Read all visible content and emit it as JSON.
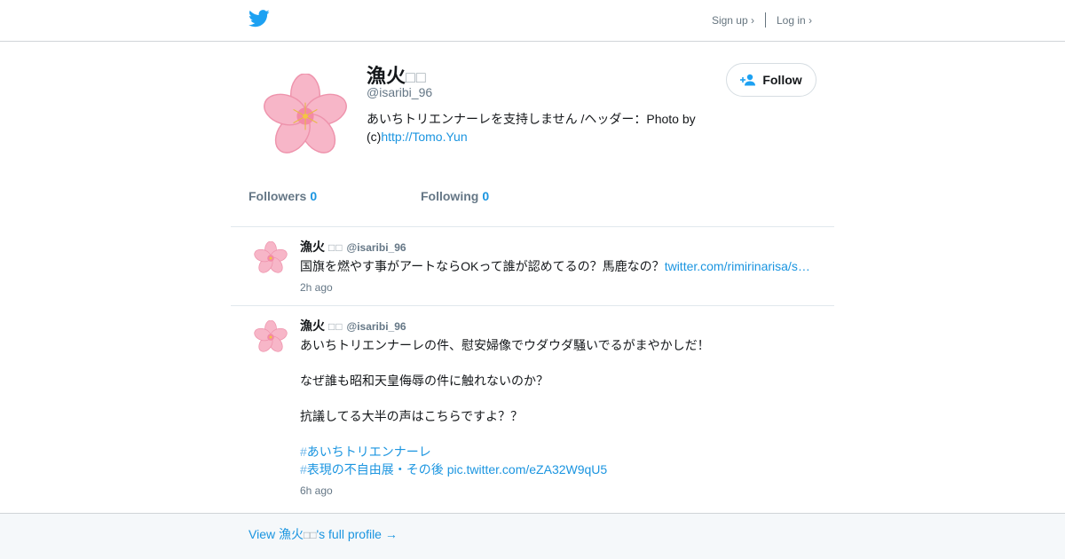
{
  "header": {
    "logo_icon": "twitter-bird-icon",
    "brand_color": "#1da1f2",
    "signup_label": "Sign up ›",
    "login_label": "Log in ›"
  },
  "profile": {
    "name": "漁火",
    "name_glyphs": "□□",
    "handle": "@isaribi_96",
    "bio_text": "あいちトリエンナーレを支持しません  /ヘッダー：Photo by (c)",
    "bio_link": "http://Tomo.Yun",
    "avatar_icon": "cherry-blossom-icon",
    "follow_label": "Follow",
    "follow_icon": "add-user-icon",
    "followers_label": "Followers",
    "followers_count": "0",
    "following_label": "Following",
    "following_count": "0"
  },
  "tweets": [
    {
      "name": "漁火",
      "name_glyphs": "□□",
      "handle": "@isaribi_96",
      "text": "国旗を燃やす事がアートならOKって誰が認めてるの？馬鹿なの？",
      "link": "twitter.com/rimirinarisa/s…",
      "time": "2h ago"
    },
    {
      "name": "漁火",
      "name_glyphs": "□□",
      "handle": "@isaribi_96",
      "line1": "あいちトリエンナーレの件、慰安婦像でウダウダ騒いでるがまやかしだ！",
      "line2": "なぜ誰も昭和天皇侮辱の件に触れないのか？",
      "line3": "抗議してる大半の声はこちらですよ？？",
      "hashtag1": "あいちトリエンナーレ",
      "hashtag2": "表現の不自由展・その後",
      "pic_link": "pic.twitter.com/eZA32W9qU5",
      "time": "6h ago"
    }
  ],
  "footer": {
    "view_prefix": "View 漁火",
    "view_glyphs": "□□",
    "view_suffix": "'s full profile →"
  }
}
